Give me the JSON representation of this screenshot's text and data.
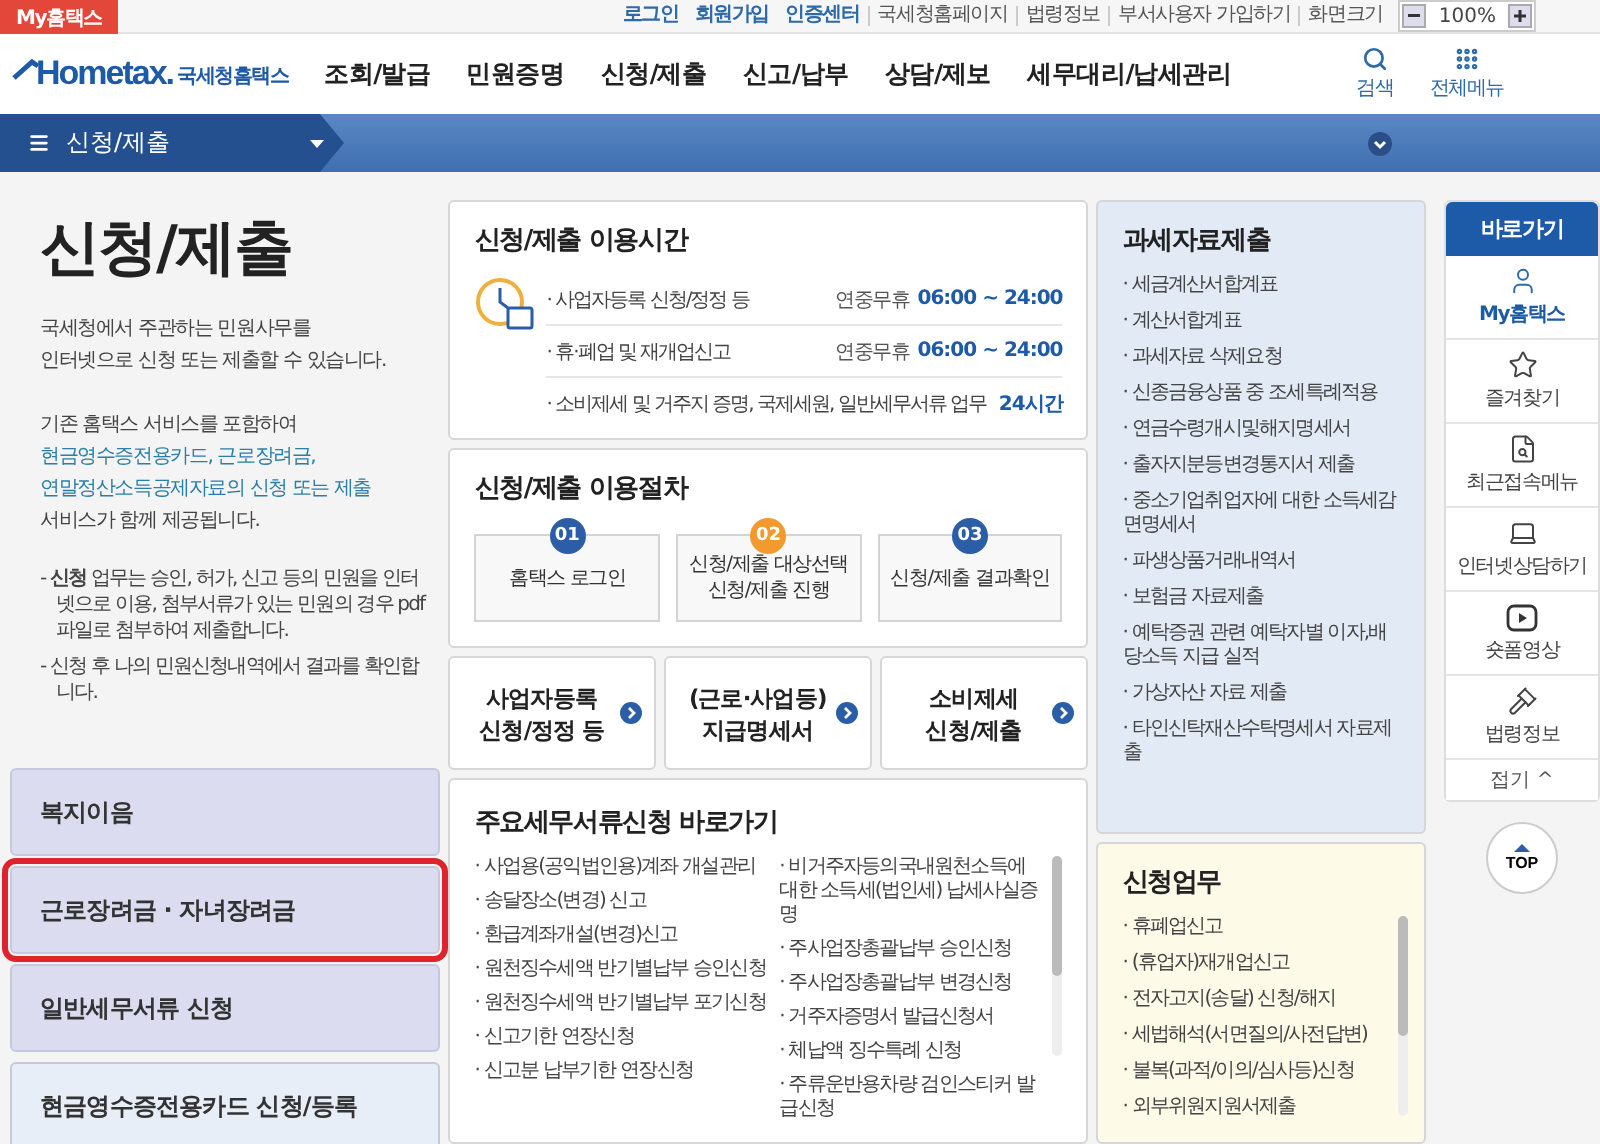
{
  "top_bar": {
    "my_tab": "My홈택스",
    "links": [
      {
        "label": "로그인",
        "kind": "account"
      },
      {
        "label": "회원가입",
        "kind": "account"
      },
      {
        "label": "인증센터",
        "kind": "account"
      },
      {
        "label": "국세청홈페이지",
        "kind": "plain"
      },
      {
        "label": "법령정보",
        "kind": "plain"
      },
      {
        "label": "부서사용자 가입하기",
        "kind": "plain"
      },
      {
        "label": "화면크기",
        "kind": "plain"
      }
    ],
    "zoom": "100%"
  },
  "header": {
    "logo": "Hometax.",
    "logo_subtitle": "국세청홈택스",
    "nav": [
      "조회/발급",
      "민원증명",
      "신청/제출",
      "신고/납부",
      "상담/제보",
      "세무대리/납세관리"
    ],
    "tools": [
      "검색",
      "전체메뉴"
    ]
  },
  "section_bar": {
    "title": "신청/제출"
  },
  "intro": {
    "title": "신청/제출",
    "description": "국세청에서 주관하는 민원사무를\n인터넷으로 신청 또는 제출할 수 있습니다.",
    "services_lead": "기존 홈택스 서비스를 포함하여",
    "services_highlight": "현금영수증전용카드, 근로장려금,\n연말정산소득공제자료의 신청 또는 제출",
    "services_tail": "서비스가 함께 제공됩니다.",
    "notes": [
      "- **신청** 업무는 승인, 허가, 신고 등의 민원을 인터넷으로 이용, 첨부서류가 있는 민원의 경우 pdf파일로 첨부하여 제출합니다.",
      "- 신청 후 나의 민원신청내역에서 결과를 확인합니다."
    ]
  },
  "left_menu": [
    {
      "label": "복지이음",
      "kind": "service",
      "highlighted": false
    },
    {
      "label": "근로장려금 · 자녀장려금",
      "kind": "service",
      "highlighted": true
    },
    {
      "label": "일반세무서류 신청",
      "kind": "service",
      "highlighted": false
    },
    {
      "label": "현금영수증전용카드 신청/등록",
      "kind": "card",
      "highlighted": false
    }
  ],
  "hours": {
    "title": "신청/제출 이용시간",
    "rows": [
      {
        "label": "· 사업자등록 신청/정정 등",
        "note": "연중무휴",
        "time": "06:00 ~ 24:00"
      },
      {
        "label": "· 휴·폐업 및 재개업신고",
        "note": "연중무휴",
        "time": "06:00 ~ 24:00"
      },
      {
        "label": "· 소비제세 및 거주지 증명, 국제세원, 일반세무서류 업무",
        "time": "24시간"
      }
    ]
  },
  "procedure": {
    "title": "신청/제출 이용절차",
    "steps": [
      {
        "number": "01",
        "label": "홈택스 로그인",
        "color": "#2b5ea7"
      },
      {
        "number": "02",
        "label": "신청/제출 대상선택\n신청/제출 진행",
        "color": "#f29a2e"
      },
      {
        "number": "03",
        "label": "신청/제출 결과확인",
        "color": "#2b5ea7"
      }
    ]
  },
  "shortcuts": [
    "사업자등록\n신청/정정 등",
    "(근로·사업등)\n지급명세서",
    "소비제세\n신청/제출"
  ],
  "documents": {
    "title": "주요세무서류신청 바로가기",
    "column_1": [
      "· 사업용(공익법인용)계좌 개설관리",
      "· 송달장소(변경) 신고",
      "· 환급계좌개설(변경)신고",
      "· 원천징수세액 반기별납부 승인신청",
      "· 원천징수세액 반기별납부 포기신청",
      "· 신고기한 연장신청",
      "· 신고분 납부기한 연장신청"
    ],
    "column_2": [
      "· 비거주자등의국내원천소득에 대한 소득세(법인세) 납세사실증명",
      "· 주사업장총괄납부 승인신청",
      "· 주사업장총괄납부 변경신청",
      "· 거주자증명서 발급신청서",
      "· 체납액 징수특례 신청",
      "· 주류운반용차량 검인스티커 발급신청"
    ]
  },
  "tax_data": {
    "title": "과세자료제출",
    "items": [
      "· 세금계산서합계표",
      "· 계산서합계표",
      "· 과세자료 삭제요청",
      "· 신종금융상품 중 조세특례적용",
      "· 연금수령개시및해지명세서",
      "· 출자지분등변경통지서 제출",
      "· 중소기업취업자에 대한 소득세감면명세서",
      "· 파생상품거래내역서",
      "· 보험금 자료제출",
      "· 예탁증권 관련 예탁자별 이자,배당소득 지급 실적",
      "· 가상자산 자료 제출",
      "· 타인신탁재산수탁명세서 자료제출"
    ]
  },
  "requests": {
    "title": "신청업무",
    "items": [
      "· 휴폐업신고",
      "· (휴업자)재개업신고",
      "· 전자고지(송달) 신청/해지",
      "· 세법해석(서면질의/사전답변)",
      "· 불복(과적/이의/심사등)신청",
      "· 외부위원지원서제출"
    ]
  },
  "quick_links": {
    "title": "바로가기",
    "items": [
      {
        "label": "My홈택스",
        "selected": true
      },
      {
        "label": "즐겨찾기",
        "selected": false
      },
      {
        "label": "최근접속메뉴",
        "selected": false
      },
      {
        "label": "인터넷상담하기",
        "selected": false
      },
      {
        "label": "숏폼영상",
        "selected": false
      },
      {
        "label": "법령정보",
        "selected": false
      }
    ],
    "collapse": "접기 ^",
    "top": "TOP"
  }
}
